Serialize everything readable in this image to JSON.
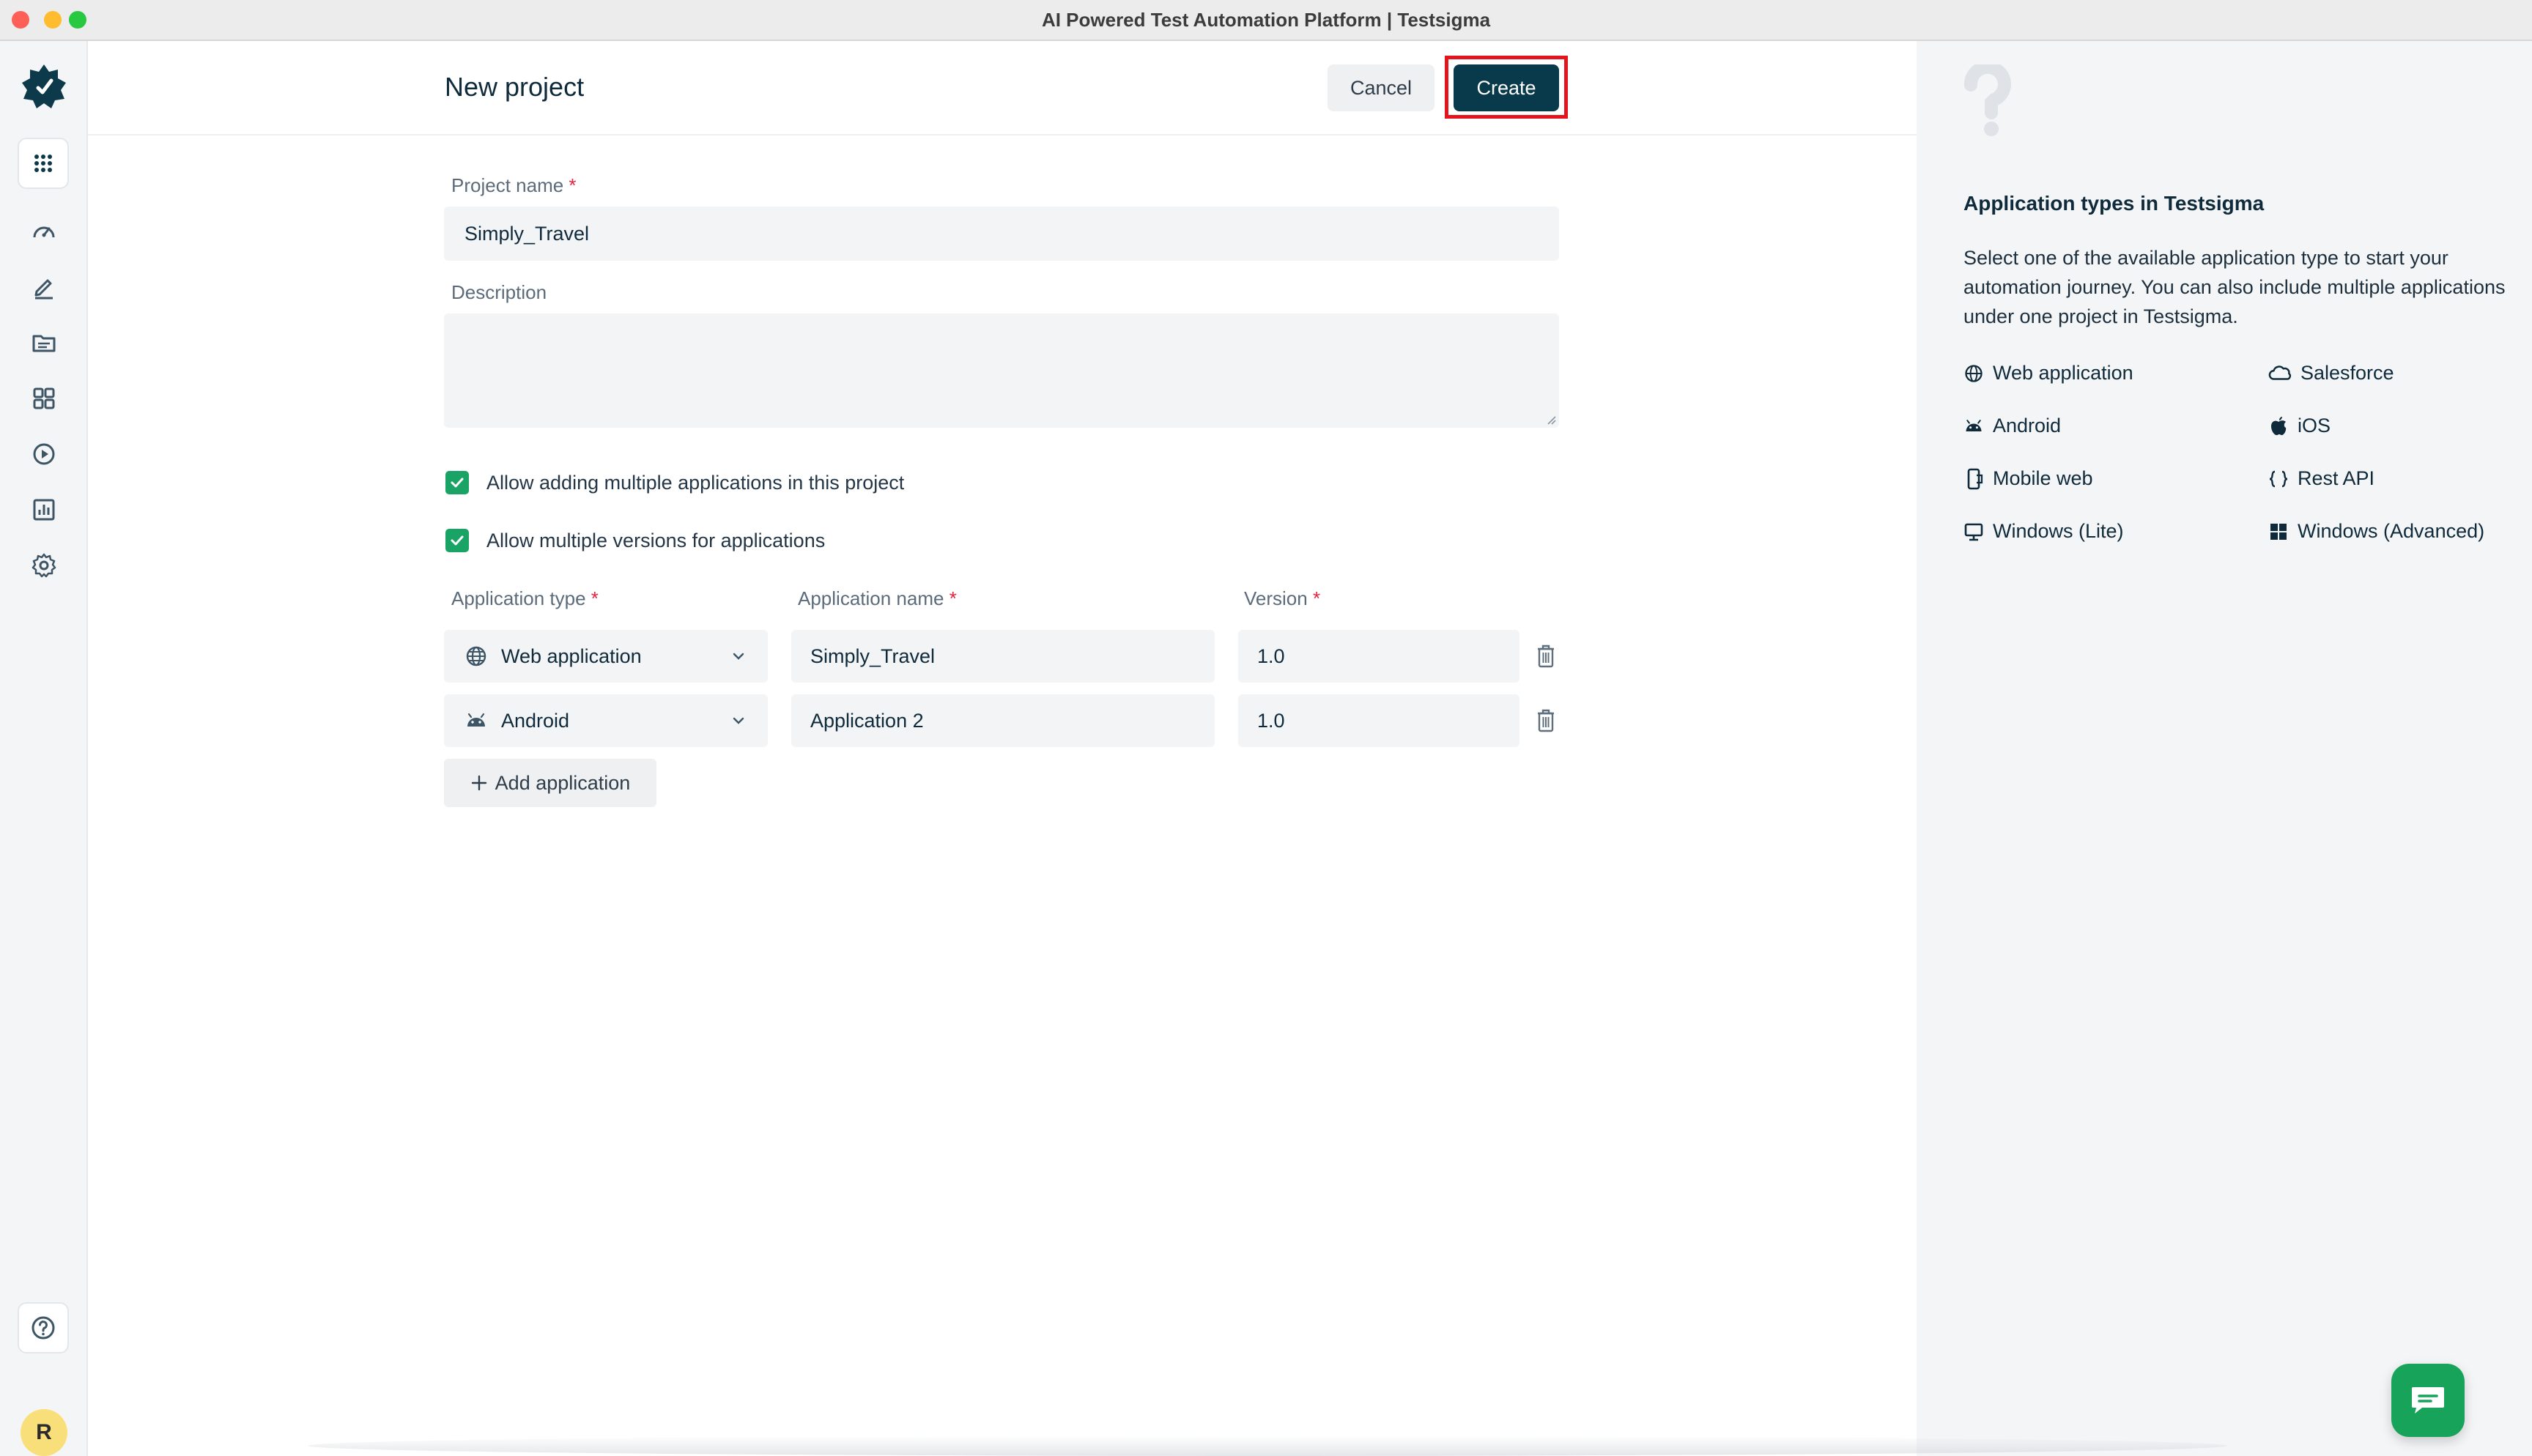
{
  "window": {
    "title": "AI Powered Test Automation Platform | Testsigma"
  },
  "user": {
    "initial": "R"
  },
  "sidebar": {
    "items": [
      {
        "icon": "apps-grid-icon"
      },
      {
        "icon": "dashboard-gauge-icon"
      },
      {
        "icon": "edit-pencil-icon"
      },
      {
        "icon": "folder-icon"
      },
      {
        "icon": "modules-grid-icon"
      },
      {
        "icon": "run-play-icon"
      },
      {
        "icon": "reports-chart-icon"
      },
      {
        "icon": "settings-gear-icon"
      },
      {
        "icon": "help-question-icon"
      }
    ]
  },
  "header": {
    "title": "New project",
    "cancel_label": "Cancel",
    "create_label": "Create"
  },
  "form": {
    "project_name_label": "Project name",
    "project_name_value": "Simply_Travel",
    "description_label": "Description",
    "description_value": "",
    "required_marker": "*",
    "checkbox_multiple_apps": "Allow adding multiple applications in this project",
    "checkbox_multiple_versions": "Allow multiple versions for applications",
    "columns": {
      "type": "Application type",
      "name": "Application name",
      "version": "Version"
    },
    "applications": [
      {
        "type": "Web application",
        "type_icon": "globe-icon",
        "name": "Simply_Travel",
        "version": "1.0"
      },
      {
        "type": "Android",
        "type_icon": "android-icon",
        "name": "Application 2",
        "version": "1.0"
      }
    ],
    "add_application_label": "Add application"
  },
  "help_panel": {
    "title": "Application types in Testsigma",
    "description": "Select one of the available application type to start your automation journey. You can also include multiple applications under one project in Testsigma.",
    "app_types": [
      {
        "label": "Web application",
        "icon": "globe-icon"
      },
      {
        "label": "Salesforce",
        "icon": "cloud-icon"
      },
      {
        "label": "Android",
        "icon": "android-icon"
      },
      {
        "label": "iOS",
        "icon": "apple-icon"
      },
      {
        "label": "Mobile web",
        "icon": "mobile-icon"
      },
      {
        "label": "Rest API",
        "icon": "braces-icon"
      },
      {
        "label": "Windows (Lite)",
        "icon": "monitor-icon"
      },
      {
        "label": "Windows (Advanced)",
        "icon": "windows-icon"
      }
    ]
  },
  "colors": {
    "primary": "#093a4b",
    "checkbox": "#19a466",
    "highlight": "#e3141b",
    "chat": "#17a35a",
    "required": "#e5233a"
  }
}
